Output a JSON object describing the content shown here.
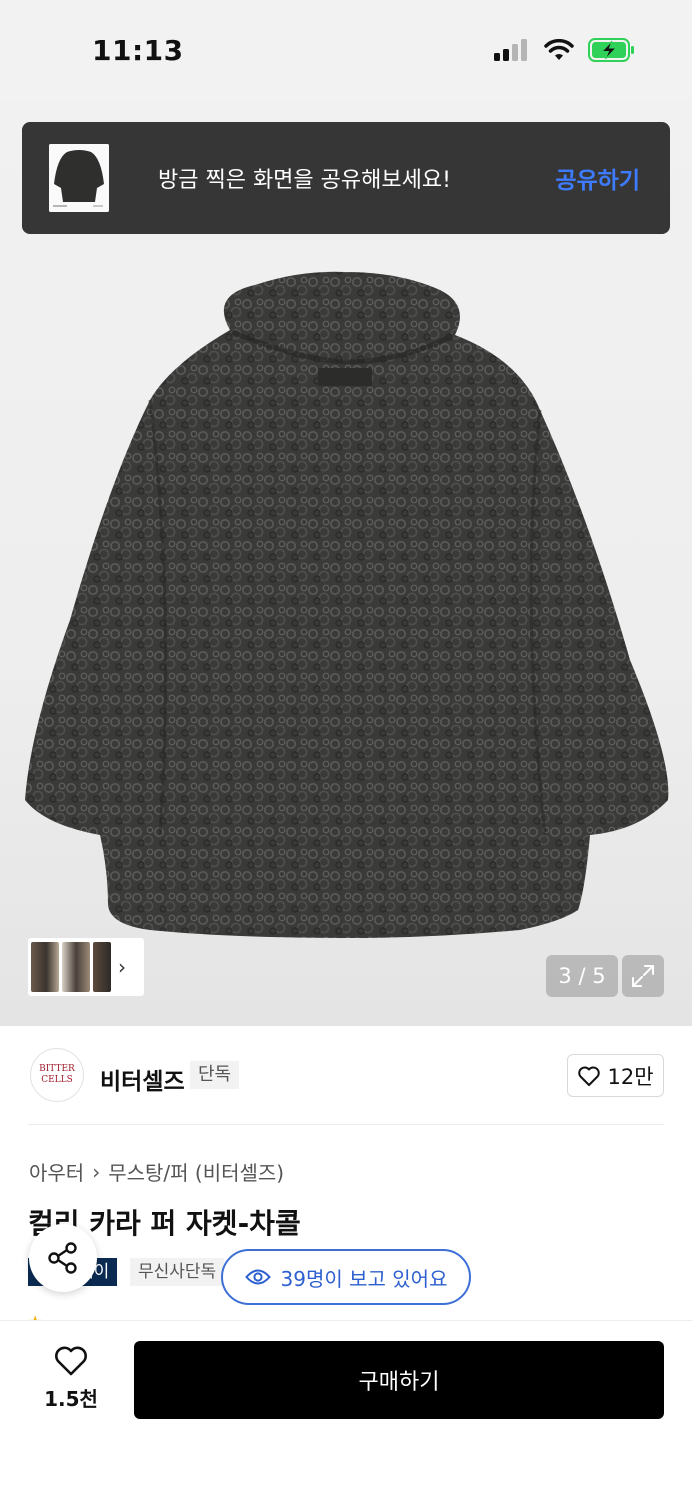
{
  "status_bar": {
    "time": "11:13",
    "battery_color": "#30d158"
  },
  "toast": {
    "message": "방금 찍은 화면을 공유해보세요!",
    "action_label": "공유하기",
    "action_color": "#3d7bff"
  },
  "gallery": {
    "counter": "3 / 5"
  },
  "brand": {
    "name": "비터셀즈",
    "tag": "단독",
    "logo_line1": "BITTER",
    "logo_line2": "CELLS",
    "likes": "12만"
  },
  "breadcrumb": {
    "category": "아우터",
    "subcategory": "무스탕/퍼 (비터셀즈)"
  },
  "product": {
    "title": "컬리 카라 퍼 자켓-차콜"
  },
  "badges": {
    "pay": "페이",
    "exclusive": "무신사단독"
  },
  "viewers": {
    "text": "39명이 보고 있어요",
    "color": "#2c5fcf"
  },
  "bottom": {
    "wish_count": "1.5천",
    "buy_label": "구매하기"
  }
}
